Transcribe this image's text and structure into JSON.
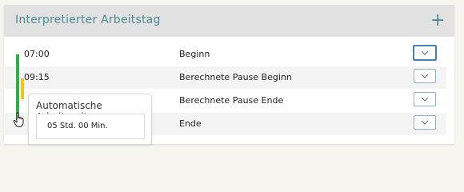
{
  "panel": {
    "title": "Interpretierter Arbeitstag",
    "add_label": "+"
  },
  "rows": [
    {
      "time": "07:00",
      "label": "Beginn"
    },
    {
      "time": "09:15",
      "label": "Berechnete Pause Beginn"
    },
    {
      "time": "",
      "label": "Berechnete Pause Ende"
    },
    {
      "time": "",
      "label": "Ende"
    }
  ],
  "tooltip": {
    "title": "Automatische Arbeitszeit",
    "value": "05 Std. 00 Min."
  },
  "colors": {
    "accent": "#4d8a93",
    "work_bar": "#2fae49",
    "pause_bar": "#f2c417"
  },
  "icons": {
    "add": "plus-icon",
    "dropdown": "chevron-down-icon",
    "cursor": "hand-pointer-icon"
  }
}
